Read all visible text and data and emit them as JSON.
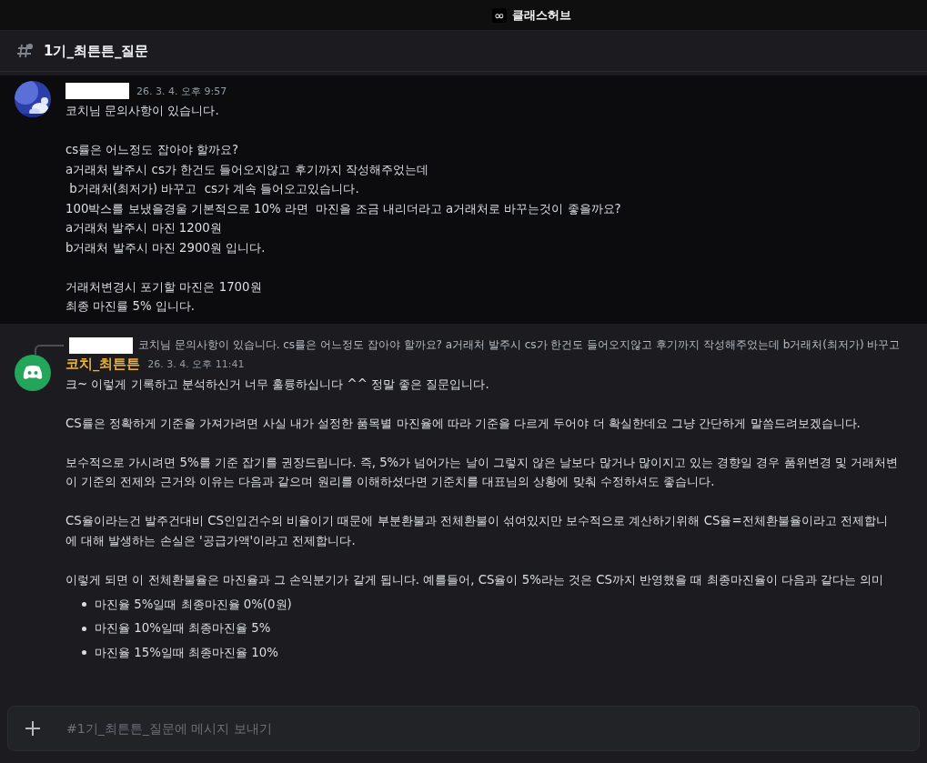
{
  "app_title": {
    "icon": "∞",
    "text": "클래스허브"
  },
  "channel": {
    "name": "1기_최튼튼_질문"
  },
  "messages": [
    {
      "author": {
        "kind": "redacted"
      },
      "time": "26. 3. 4. 오후 9:57",
      "highlighted": true,
      "blocks": [
        {
          "kind": "p",
          "lines": [
            "코치님 문의사항이 있습니다."
          ]
        },
        {
          "kind": "p",
          "lines": [
            "cs률은 어느정도 잡아야 할까요?",
            "a거래처 발주시 cs가 한건도 들어오지않고 후기까지 작성해주었는데",
            " b거래처(최저가) 바꾸고  cs가 계속 들어오고있습니다.",
            "100박스를 보냈을경울 기본적으로 10% 라면  마진을 조금 내리더라고 a거래처로 바꾸는것이 좋을까요?",
            "a거래처 발주시 마진 1200원",
            "b거래처 발주시 마진 2900원 입니다."
          ]
        },
        {
          "kind": "p",
          "lines": [
            "거래처변경시 포기할 마진은 1700원",
            "최종 마진률 5% 입니다."
          ]
        }
      ]
    },
    {
      "avatar": {
        "kind": "bot"
      },
      "author": {
        "kind": "name",
        "text": "코치_최튼튼"
      },
      "time": "26. 3. 4. 오후 11:41",
      "highlighted": false,
      "reply": {
        "text": "코치님 문의사항이 있습니다.  cs률은 어느정도 잡아야 할까요?  a거래처 발주시 cs가 한건도 들어오지않고 후기까지 작성해주었는데  b거래처(최저가) 바꾸고"
      },
      "blocks": [
        {
          "kind": "p",
          "lines": [
            "크~ 이렇게 기록하고 분석하신거 너무 훌륭하십니다 ^^ 정말 좋은 질문입니다."
          ]
        },
        {
          "kind": "p",
          "lines": [
            "CS률은 정확하게 기준을 가져가려면 사실 내가 설정한 품목별 마진율에 따라 기준을 다르게 두어야 더 확실한데요 그냥 간단하게 말씀드려보겠습니다."
          ]
        },
        {
          "kind": "p",
          "lines": [
            "보수적으로 가시려면 5%를 기준 잡기를 권장드립니다. 즉, 5%가 넘어가는 날이 그렇지 않은 날보다 많거나 많이지고 있는 경향일 경우 품위변경 및 거래처변",
            "이 기준의 전제와 근거와 이유는 다음과 같으며 원리를 이해하셨다면 기준치를 대표님의 상황에 맞춰 수정하셔도 좋습니다."
          ]
        },
        {
          "kind": "p",
          "lines": [
            "CS율이라는건 발주건대비 CS인입건수의 비율이기 때문에 부분환불과 전체환불이 섞여있지만 보수적으로 계산하기위해 CS율=전체환불율이라고 전제합니",
            "에 대해 발생하는 손실은 '공급가액'이라고 전제합니다."
          ]
        },
        {
          "kind": "p",
          "lines": [
            "이렇게 되면 이 전체환불율은 마진율과 그 손익분기가 같게 됩니다. 예를들어, CS율이 5%라는 것은 CS까지 반영했을 때 최종마진율이 다음과 같다는 의미"
          ]
        },
        {
          "kind": "list",
          "items": [
            "마진율 5%일때 최종마진율 0%(0원)",
            "마진율 10%일때 최종마진율 5%",
            "마진율 15%일때 최종마진율 10%"
          ]
        }
      ]
    }
  ],
  "composer": {
    "placeholder": "#1기_최튼튼_질문에 메시지 보내기"
  }
}
